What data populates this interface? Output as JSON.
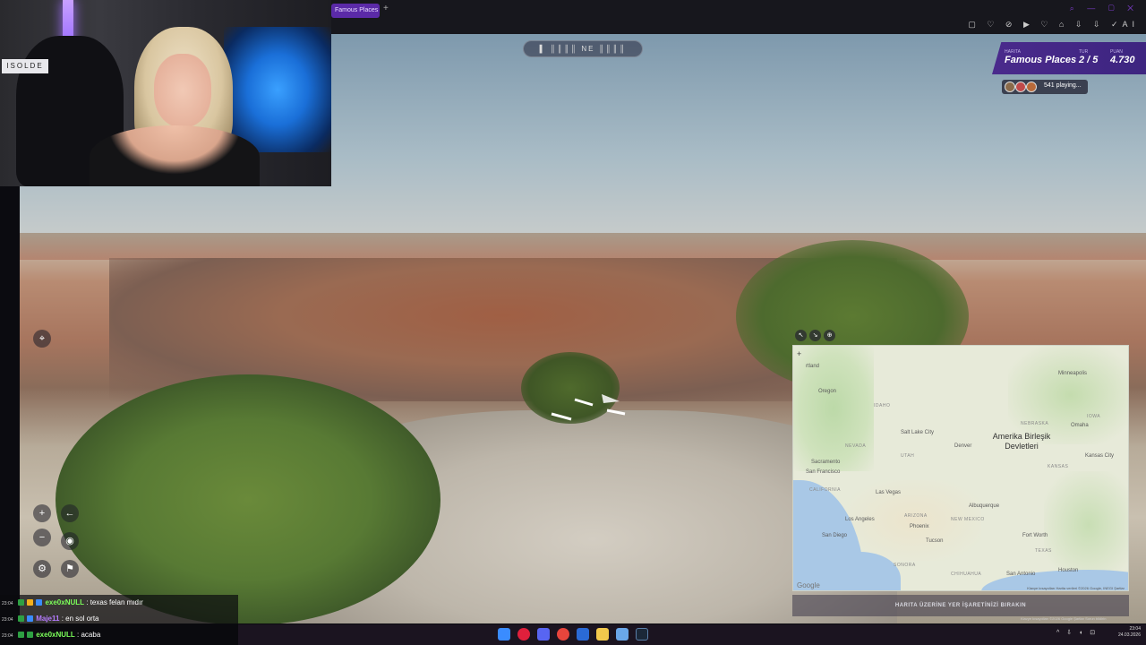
{
  "browser": {
    "tab_title": "Famous Places - Gam",
    "new_tab_glyph": "+",
    "window_controls": "⌕ — ▢ ✕",
    "toolbar_icons": "▢ ♡ ⊘ ▶ ♡ ⌂ ⇩ ⇩ ✓AI",
    "ai_label": "AI"
  },
  "game": {
    "status": {
      "map_label": "HARITA",
      "map_value": "Famous Places",
      "round_label": "TUR",
      "round_value": "2 / 5",
      "points_label": "PUAN",
      "points_value": "4.730"
    },
    "players_text": "541 playing...",
    "pause_bar": "▌ ║║║║ NE ║║║║"
  },
  "webcam": {
    "sign": "ISOLDE"
  },
  "map": {
    "country": "Amerika Birleşik Devletleri",
    "cities": [
      {
        "name": "Minneapolis"
      },
      {
        "name": "Oregon"
      },
      {
        "name": "Salt Lake City"
      },
      {
        "name": "Denver"
      },
      {
        "name": "Omaha"
      },
      {
        "name": "Kansas City"
      },
      {
        "name": "Sacramento"
      },
      {
        "name": "San Francisco"
      },
      {
        "name": "Las Vegas"
      },
      {
        "name": "Albuquerque"
      },
      {
        "name": "Los Angeles"
      },
      {
        "name": "Phoenix"
      },
      {
        "name": "San Diego"
      },
      {
        "name": "Tucson"
      },
      {
        "name": "Fort Worth"
      },
      {
        "name": "San Antonio"
      },
      {
        "name": "Houston"
      }
    ],
    "states": [
      "NEVADA",
      "UTAH",
      "CALIFORNIA",
      "ARIZONA",
      "NEW MEXICO",
      "NEBRASKA",
      "IOWA",
      "KANSAS",
      "TEXAS",
      "SONORA",
      "CHIHUAHUA",
      "IDAHO"
    ],
    "google": "Google",
    "attribution": "Klavye kısayolları   Harita verileri ©2026 Google, INEGI   Şartlar",
    "guess_prompt": "HARITA ÜZERİNE YER İŞARETİNİZİ BIRAKIN",
    "footer": "Klavye kısayolları  ©2026 Google  Şartlar  Sorun bildirin",
    "top_left_label": "rtland"
  },
  "chat": [
    {
      "time": "23:04",
      "user": "exe0xNULL",
      "message": ": texas felan mıdır",
      "color": "#7cff5a"
    },
    {
      "time": "23:04",
      "user": "Maje11",
      "message": ": en sol orta",
      "color": "#b57cff"
    },
    {
      "time": "23:04",
      "user": "exe0xNULL",
      "message": ": acaba",
      "color": "#7cff5a"
    }
  ],
  "taskbar": {
    "time": "23:04",
    "date": "24.03.2026"
  },
  "colors": {
    "accent": "#5b2aa8",
    "status_panel": "#4a2a8c"
  }
}
